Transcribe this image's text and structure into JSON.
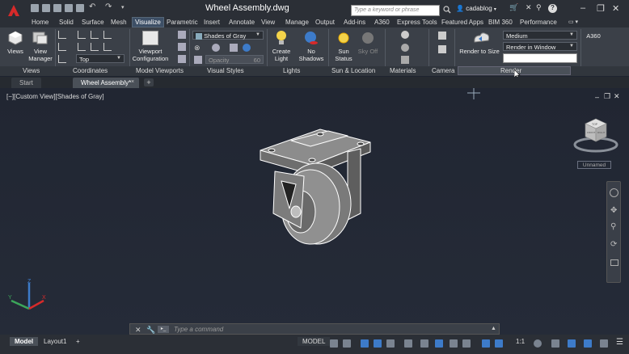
{
  "title_bar": {
    "document_title": "Wheel Assembly.dwg",
    "search_placeholder": "Type a keyword or phrase",
    "user_name": "cadablog",
    "icons": [
      "application-menu-icon",
      "new-icon",
      "open-icon",
      "save-icon",
      "save-as-icon",
      "print-icon",
      "undo-icon",
      "redo-icon",
      "search-icon",
      "user-icon",
      "exchange-icon",
      "help-icon",
      "minimize-icon",
      "restore-icon",
      "close-icon"
    ]
  },
  "ribbon_tabs": [
    {
      "label": "Home",
      "active": false
    },
    {
      "label": "Solid",
      "active": false
    },
    {
      "label": "Surface",
      "active": false
    },
    {
      "label": "Mesh",
      "active": false
    },
    {
      "label": "Visualize",
      "active": true
    },
    {
      "label": "Parametric",
      "active": false
    },
    {
      "label": "Insert",
      "active": false
    },
    {
      "label": "Annotate",
      "active": false
    },
    {
      "label": "View",
      "active": false
    },
    {
      "label": "Manage",
      "active": false
    },
    {
      "label": "Output",
      "active": false
    },
    {
      "label": "Add-ins",
      "active": false
    },
    {
      "label": "A360",
      "active": false
    },
    {
      "label": "Express Tools",
      "active": false
    },
    {
      "label": "Featured Apps",
      "active": false
    },
    {
      "label": "BIM 360",
      "active": false
    },
    {
      "label": "Performance",
      "active": false
    }
  ],
  "ribbon": {
    "views_btn": "Views",
    "view_manager_btn": "View\nManager",
    "named_view": "Top",
    "viewport_config_btn": "Viewport\nConfiguration",
    "visual_style": "Shades of Gray",
    "opacity_label": "Opacity",
    "opacity_value": "60",
    "create_light_btn": "Create\nLight",
    "no_shadows_btn": "No\nShadows",
    "sun_status_btn": "Sun\nStatus",
    "sky_off_btn": "Sky Off",
    "render_to_size_btn": "Render to Size",
    "render_quality": "Medium",
    "render_target": "Render in Window",
    "a360_label": "A360",
    "groups": [
      "Views",
      "Coordinates",
      "Model Viewports",
      "Visual Styles",
      "Lights",
      "Sun & Location",
      "Materials",
      "Camera",
      "Render"
    ]
  },
  "file_tabs": [
    {
      "label": "Start",
      "active": false
    },
    {
      "label": "Wheel Assembly*",
      "active": true
    }
  ],
  "viewport": {
    "label": "[−][Custom View][Shades of Gray]",
    "viewcube_label": "Unnamed",
    "viewcube_faces": {
      "top": "TOP",
      "front": "FRONT",
      "right": "RIGHT"
    }
  },
  "command_line": {
    "placeholder": "Type a command"
  },
  "status_bar": {
    "layout_tabs": [
      {
        "label": "Model",
        "active": true
      },
      {
        "label": "Layout1",
        "active": false
      }
    ],
    "model_button": "MODEL",
    "annotation_scale": "1:1"
  },
  "colors": {
    "accent": "#d62a2a",
    "active_tab": "#3d4f66",
    "viewport_bg": "#212632"
  }
}
